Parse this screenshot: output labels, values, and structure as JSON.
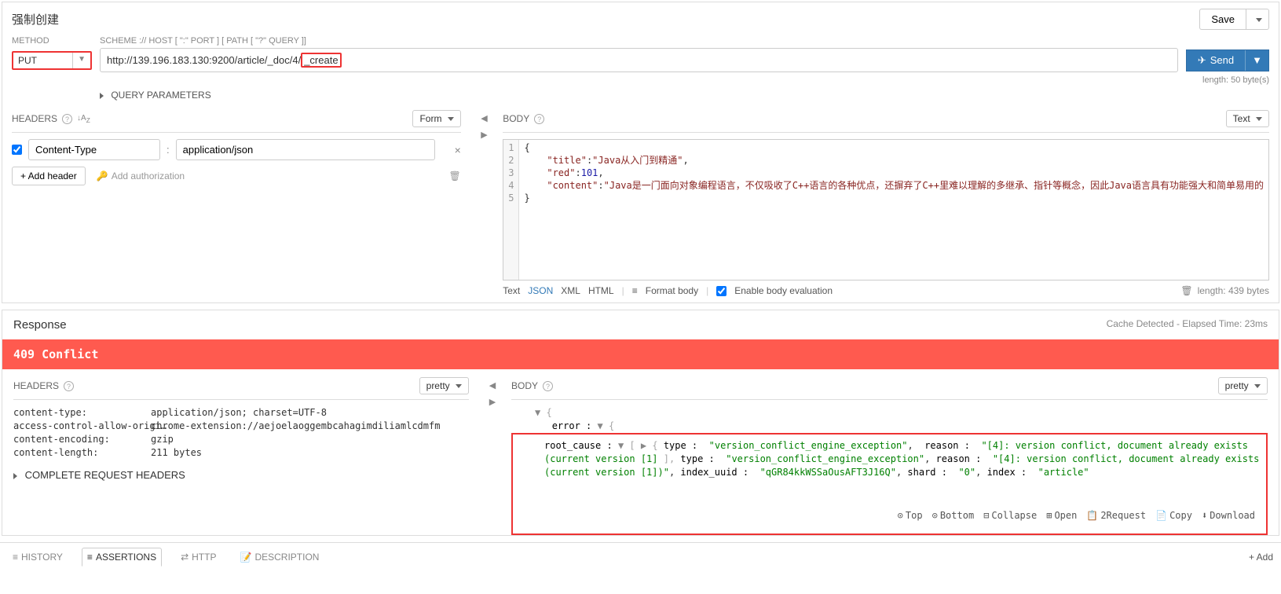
{
  "title": "强制创建",
  "save_label": "Save",
  "method_label": "METHOD",
  "scheme_label": "SCHEME :// HOST [ \":\" PORT ] [ PATH [ \"?\" QUERY ]]",
  "method_value": "PUT",
  "url_prefix": "http://139.196.183.130:9200/article/_doc/4/",
  "url_highlight": "_create",
  "send_label": "Send",
  "length_text": "length: 50 byte(s)",
  "query_params_label": "QUERY PARAMETERS",
  "headers": {
    "title": "HEADERS",
    "form_mode": "Form",
    "item_name": "Content-Type",
    "item_value": "application/json",
    "add_header": "+ Add header",
    "add_auth": "Add authorization"
  },
  "body": {
    "title": "BODY",
    "mode": "Text",
    "lines": [
      "1",
      "2",
      "3",
      "4",
      "5"
    ],
    "json_title_key": "\"title\"",
    "json_title_val": "\"Java从入门到精通\"",
    "json_red_key": "\"red\"",
    "json_red_val": "101",
    "json_content_key": "\"content\"",
    "json_content_val": "\"Java是一门面向对象编程语言，不仅吸收了C++语言的各种优点，还摒弃了C++里难以理解的多继承、指针等概念，因此Java语言具有功能强大和简单易用的",
    "footer_text": "Text",
    "footer_json": "JSON",
    "footer_xml": "XML",
    "footer_html": "HTML",
    "footer_format": "Format body",
    "footer_eval": "Enable body evaluation",
    "footer_length": "length: 439 bytes"
  },
  "response": {
    "title": "Response",
    "note": "Cache Detected - Elapsed Time: 23ms",
    "status": "409 Conflict",
    "headers_title": "HEADERS",
    "headers_mode": "pretty",
    "body_title": "BODY",
    "body_mode": "pretty",
    "resp_headers": [
      {
        "k": "content-type:",
        "v": "application/json; charset=UTF-8"
      },
      {
        "k": "access-control-allow-origi…",
        "v": "chrome-extension://aejoelaoggembcahagimdiliamlcdmfm"
      },
      {
        "k": "content-encoding:",
        "v": "gzip"
      },
      {
        "k": "content-length:",
        "v": "211 bytes"
      }
    ],
    "complete_req": "COMPLETE REQUEST HEADERS",
    "jv": {
      "error": "error :",
      "root_cause": "root_cause :",
      "rc_type": "type :",
      "rc_type_v": "\"version_conflict_engine_exception\"",
      "rc_reason": "reason :",
      "rc_reason_v": "\"[4]: version conflict, document already exists (current version [1]",
      "type": "type :",
      "type_v": "\"version_conflict_engine_exception\"",
      "reason": "reason :",
      "reason_v": "\"[4]: version conflict, document already exists (current version [1])\"",
      "index_uuid": "index_uuid :",
      "index_uuid_v": "\"qGR84kkWSSaOusAFT3J16Q\"",
      "shard": "shard :",
      "shard_v": "\"0\"",
      "index": "index :",
      "index_v": "\"article\""
    },
    "actions": {
      "top": "Top",
      "bottom": "Bottom",
      "collapse": "Collapse",
      "open": "Open",
      "req": "2Request",
      "copy": "Copy",
      "download": "Download"
    }
  },
  "tabs": {
    "history": "HISTORY",
    "assertions": "ASSERTIONS",
    "http": "HTTP",
    "description": "DESCRIPTION",
    "add": "+ Add"
  }
}
